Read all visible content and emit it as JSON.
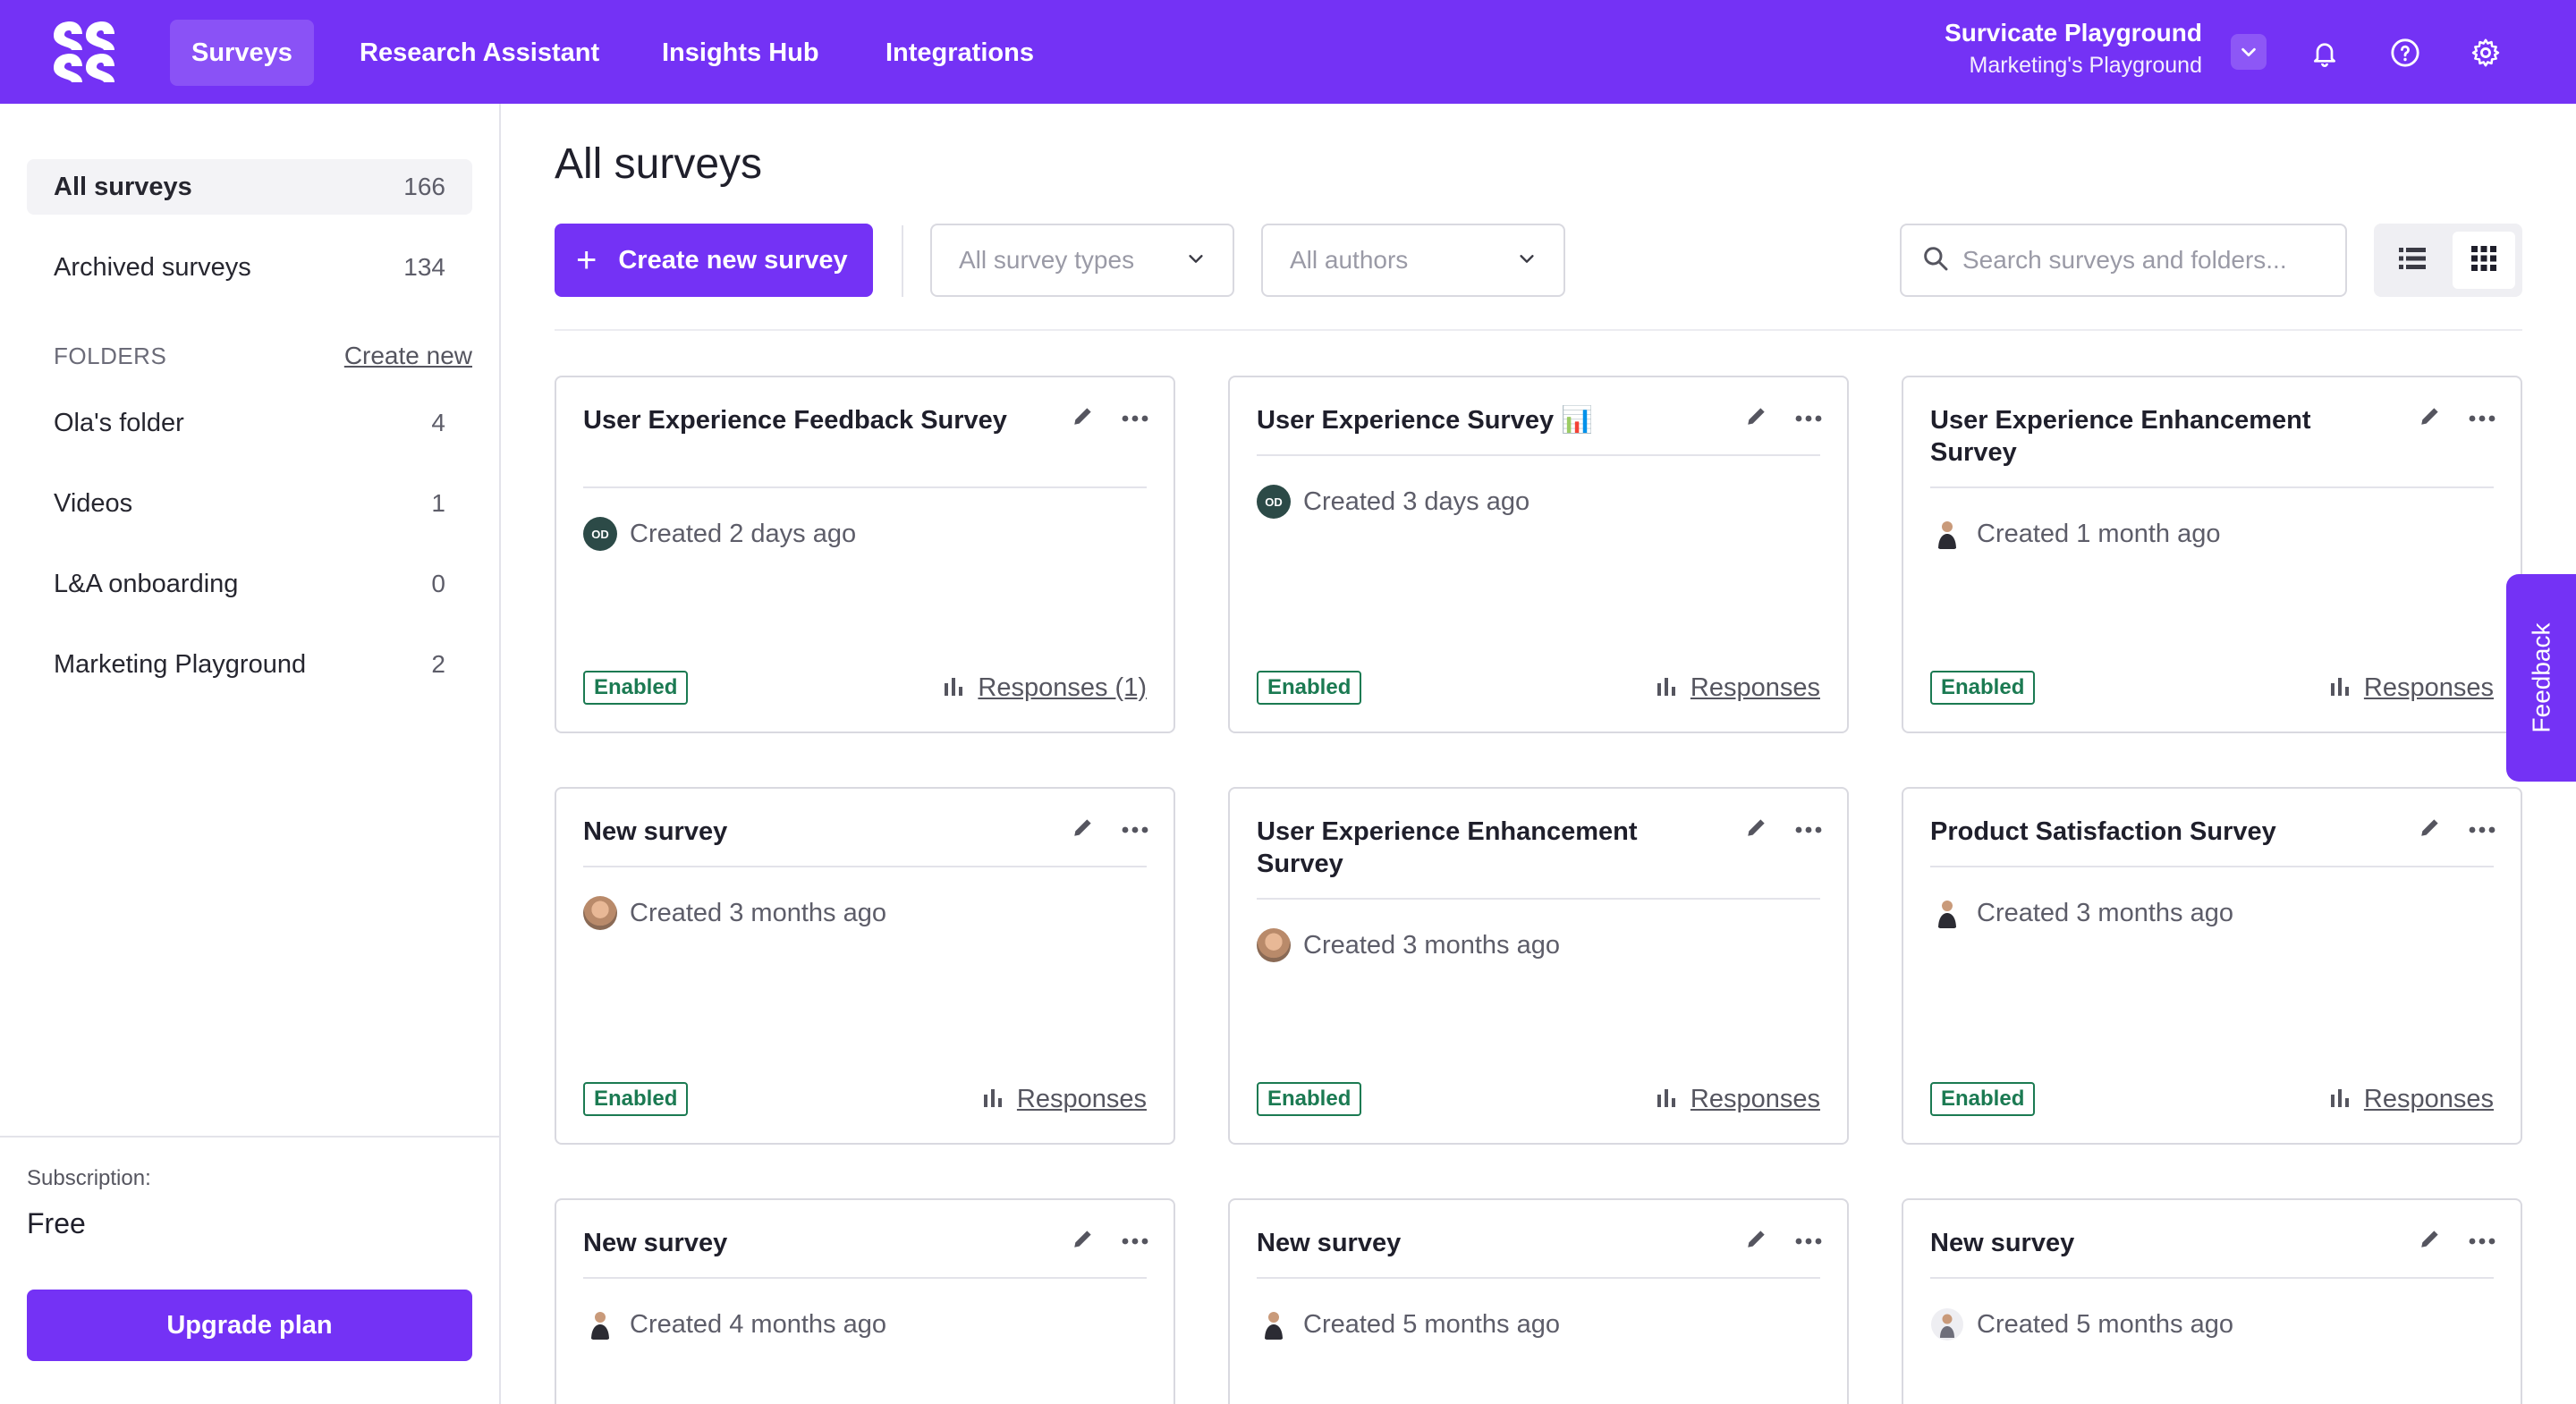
{
  "colors": {
    "brand": "#7432f5",
    "enabled": "#1b7a52",
    "text": "#1f1f2b",
    "muted": "#5d5d69"
  },
  "nav": {
    "items": [
      {
        "label": "Surveys",
        "active": true
      },
      {
        "label": "Research Assistant",
        "active": false
      },
      {
        "label": "Insights Hub",
        "active": false
      },
      {
        "label": "Integrations",
        "active": false
      }
    ],
    "account_name": "Survicate Playground",
    "account_sub": "Marketing's Playground",
    "icons": [
      "chevron-down-icon",
      "bell-icon",
      "help-icon",
      "gear-icon"
    ]
  },
  "sidebar": {
    "items": [
      {
        "label": "All surveys",
        "count": "166",
        "active": true
      },
      {
        "label": "Archived surveys",
        "count": "134",
        "active": false
      }
    ],
    "folders_label": "FOLDERS",
    "create_new": "Create new",
    "folders": [
      {
        "label": "Ola's folder",
        "count": "4"
      },
      {
        "label": "Videos",
        "count": "1"
      },
      {
        "label": "L&A onboarding",
        "count": "0"
      },
      {
        "label": "Marketing Playground",
        "count": "2"
      }
    ],
    "subscription_label": "Subscription:",
    "subscription_value": "Free",
    "upgrade_label": "Upgrade plan"
  },
  "main": {
    "title": "All surveys",
    "create_label": "Create new survey",
    "type_filter": "All survey types",
    "author_filter": "All authors",
    "search_placeholder": "Search surveys and folders..."
  },
  "cards": [
    {
      "title": "User Experience Feedback Survey",
      "created": "Created 2 days ago",
      "avatar": "OD",
      "status": "Enabled",
      "responses": "Responses (1)"
    },
    {
      "title": "User Experience Survey 📊",
      "created": "Created 3 days ago",
      "avatar": "OD",
      "status": "Enabled",
      "responses": "Responses"
    },
    {
      "title": "User Experience Enhancement Survey",
      "created": "Created 1 month ago",
      "avatar": "",
      "status": "Enabled",
      "responses": "Responses"
    },
    {
      "title": "New survey",
      "created": "Created 3 months ago",
      "avatar": "",
      "status": "Enabled",
      "responses": "Responses"
    },
    {
      "title": "User Experience Enhancement Survey",
      "created": "Created 3 months ago",
      "avatar": "",
      "status": "Enabled",
      "responses": "Responses"
    },
    {
      "title": "Product Satisfaction Survey",
      "created": "Created 3 months ago",
      "avatar": "",
      "status": "Enabled",
      "responses": "Responses"
    },
    {
      "title": "New survey",
      "created": "Created 4 months ago",
      "avatar": "",
      "status": "",
      "responses": ""
    },
    {
      "title": "New survey",
      "created": "Created 5 months ago",
      "avatar": "",
      "status": "",
      "responses": ""
    },
    {
      "title": "New survey",
      "created": "Created 5 months ago",
      "avatar": "",
      "status": "",
      "responses": ""
    }
  ],
  "feedback_tab": "Feedback"
}
